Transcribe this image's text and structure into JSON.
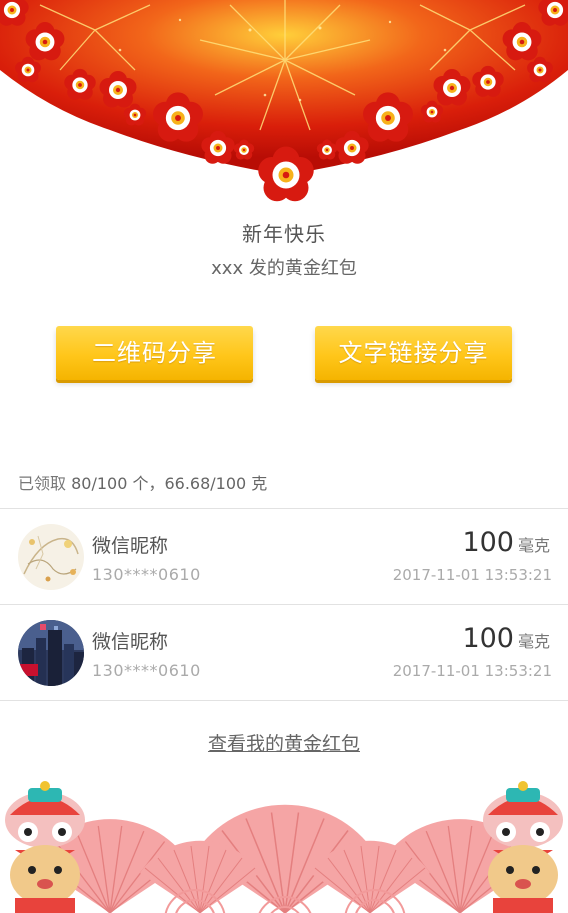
{
  "greeting": {
    "title": "新年快乐",
    "subtitle": "xxx  发的黄金红包"
  },
  "buttons": {
    "qr_share": "二维码分享",
    "text_link_share": "文字链接分享"
  },
  "summary": {
    "label": "已领取",
    "count": "80/100 个，66.68/100 克"
  },
  "records": [
    {
      "nickname": "微信昵称",
      "phone": "130****0610",
      "amount": "100",
      "unit": "毫克",
      "time": "2017-11-01 13:53:21"
    },
    {
      "nickname": "微信昵称",
      "phone": "130****0610",
      "amount": "100",
      "unit": "毫克",
      "time": "2017-11-01 13:53:21"
    }
  ],
  "footer_link": "查看我的黄金红包",
  "colors": {
    "banner_red": "#d81e06",
    "button_yellow": "#ffc61a",
    "fan_pink": "#f28a8a"
  }
}
